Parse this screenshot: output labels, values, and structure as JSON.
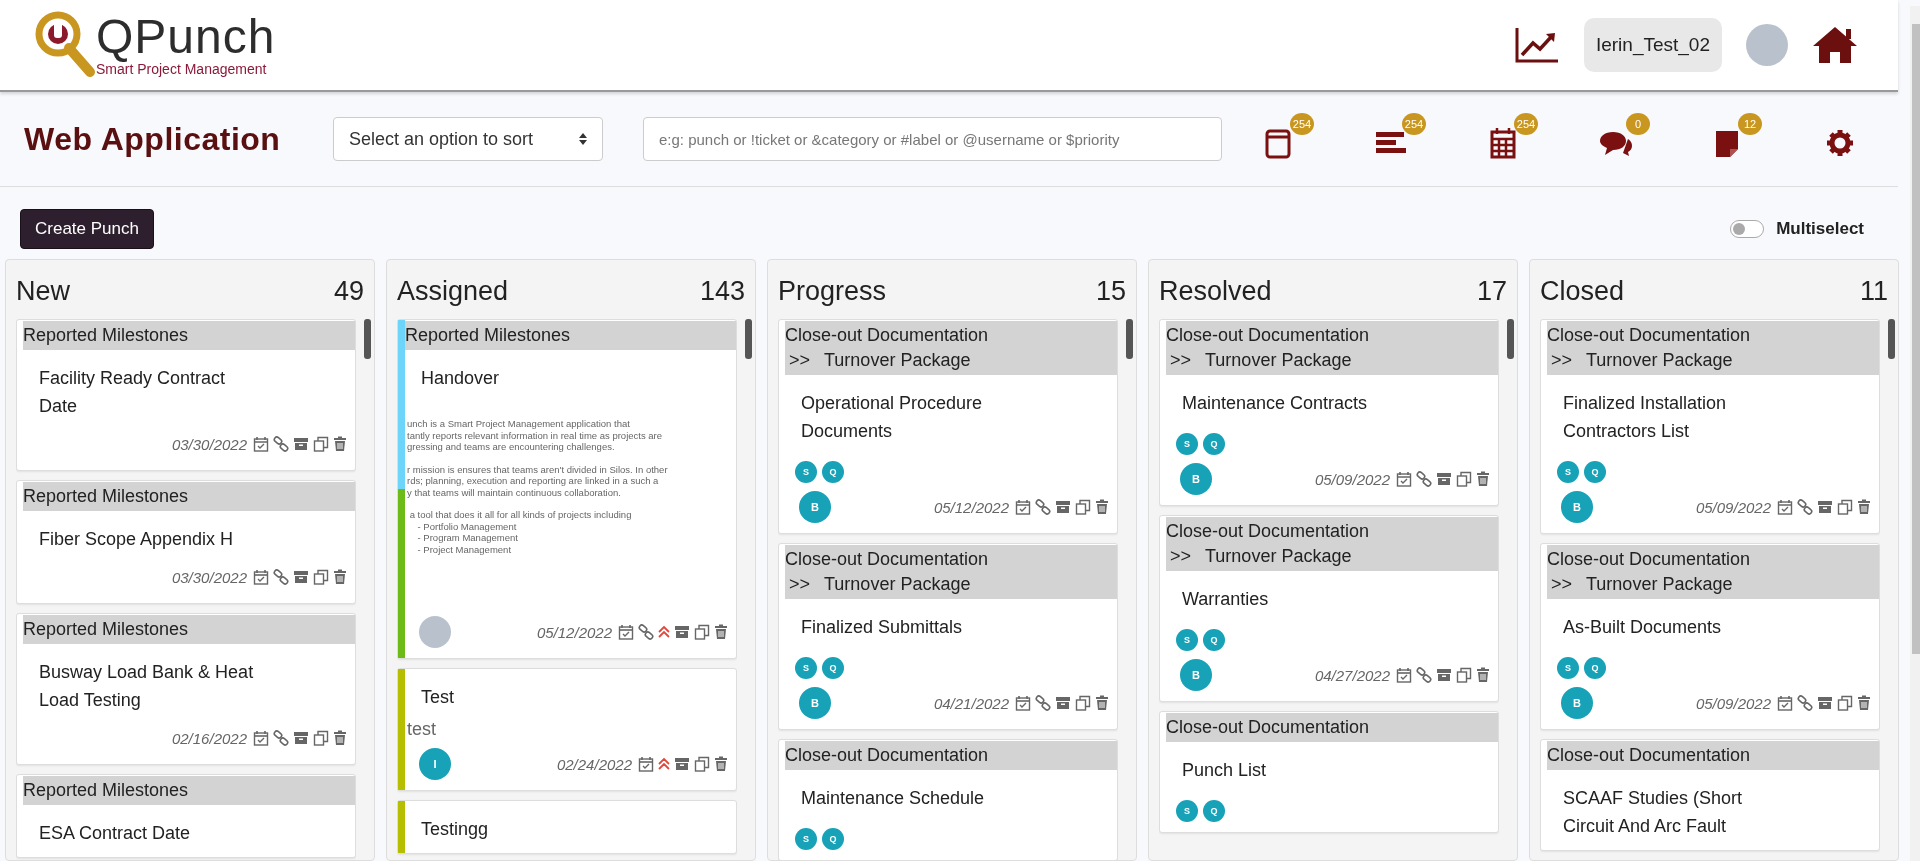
{
  "header": {
    "logo": {
      "name": "QPunch",
      "tagline": "Smart Project Management"
    },
    "user": "Ierin_Test_02"
  },
  "toolbar": {
    "title": "Web Application",
    "sort": {
      "placeholder": "Select an option to sort"
    },
    "search": {
      "placeholder": "e:g: punch or !ticket or &category or #label or @username or $priority"
    },
    "views": [
      {
        "kind": "cards",
        "badge": "254"
      },
      {
        "kind": "list",
        "badge": "254"
      },
      {
        "kind": "calendar",
        "badge": "254"
      },
      {
        "kind": "chat",
        "badge": "0"
      },
      {
        "kind": "notes",
        "badge": "12"
      },
      {
        "kind": "settings"
      }
    ]
  },
  "actions": {
    "create_button": "Create Punch",
    "multiselect": {
      "label": "Multiselect",
      "on": false
    }
  },
  "columns": [
    {
      "title": "New",
      "count": "49",
      "cards": [
        {
          "category": "Reported Milestones",
          "title": "Facility Ready Contract Date",
          "date": "03/30/2022",
          "linked": true,
          "high_priority": false
        },
        {
          "category": "Reported Milestones",
          "title": "Fiber Scope Appendix H",
          "date": "03/30/2022",
          "linked": true,
          "high_priority": false
        },
        {
          "category": "Reported Milestones",
          "title": "Busway Load Bank & Heat Load Testing",
          "date": "02/16/2022",
          "linked": true,
          "high_priority": false
        },
        {
          "category": "Reported Milestones",
          "title": "ESA Contract Date"
        }
      ]
    },
    {
      "title": "Assigned",
      "count": "143",
      "cards": [
        {
          "category": "Reported Milestones",
          "title": "Handover",
          "accent": [
            {
              "color": "#6dd5fa"
            },
            {
              "color": "#6cbb16"
            }
          ],
          "attachment_paragraphs": [
            [
              "unch is a Smart Project Management application that",
              "tantly reports relevant information in real time as projects are",
              "gressing and teams are encountering challenges."
            ],
            [
              "r mission is ensures that teams aren't divided in Silos. In other",
              "rds; planning, execution and reporting are linked in a such a",
              "y that teams will maintain continuous collaboration."
            ],
            [
              " a tool that does it all for all kinds of projects including",
              "    - Portfolio Management",
              "    - Program Management",
              "    - Project Management"
            ]
          ],
          "assignee": {
            "kind": "photo"
          },
          "date": "05/12/2022",
          "linked": true,
          "high_priority": true
        },
        {
          "title": "Test",
          "description": "test",
          "accent": [
            {
              "color": "#b5be00"
            }
          ],
          "assignee": {
            "kind": "initial",
            "initial": "I"
          },
          "date": "02/24/2022",
          "linked": false,
          "high_priority": true
        },
        {
          "title": "Testingg",
          "accent": [
            {
              "color": "#b5be00"
            }
          ]
        }
      ]
    },
    {
      "title": "Progress",
      "count": "15",
      "cards": [
        {
          "category": "Close-out Documentation",
          "subcategory": {
            "prefix": ">>",
            "name": "Turnover Package"
          },
          "title": "Operational Procedure Documents",
          "tags": [
            "S",
            "Q"
          ],
          "assignee": {
            "kind": "initial",
            "initial": "B"
          },
          "date": "05/12/2022",
          "linked": true,
          "high_priority": false
        },
        {
          "category": "Close-out Documentation",
          "subcategory": {
            "prefix": ">>",
            "name": "Turnover Package"
          },
          "title": "Finalized Submittals",
          "tags": [
            "S",
            "Q"
          ],
          "assignee": {
            "kind": "initial",
            "initial": "B"
          },
          "date": "04/21/2022",
          "linked": true,
          "high_priority": false
        },
        {
          "category": "Close-out Documentation",
          "title": "Maintenance Schedule",
          "tags": [
            "S",
            "Q"
          ]
        }
      ]
    },
    {
      "title": "Resolved",
      "count": "17",
      "cards": [
        {
          "category": "Close-out Documentation",
          "subcategory": {
            "prefix": ">>",
            "name": "Turnover Package"
          },
          "title": "Maintenance Contracts",
          "tags": [
            "S",
            "Q"
          ],
          "assignee": {
            "kind": "initial",
            "initial": "B"
          },
          "date": "05/09/2022",
          "linked": true,
          "high_priority": false
        },
        {
          "category": "Close-out Documentation",
          "subcategory": {
            "prefix": ">>",
            "name": "Turnover Package"
          },
          "title": "Warranties",
          "tags": [
            "S",
            "Q"
          ],
          "assignee": {
            "kind": "initial",
            "initial": "B"
          },
          "date": "04/27/2022",
          "linked": true,
          "high_priority": false
        },
        {
          "category": "Close-out Documentation",
          "title": "Punch List",
          "tags": [
            "S",
            "Q"
          ]
        }
      ]
    },
    {
      "title": "Closed",
      "count": "11",
      "cards": [
        {
          "category": "Close-out Documentation",
          "subcategory": {
            "prefix": ">>",
            "name": "Turnover Package"
          },
          "title": "Finalized Installation Contractors List",
          "tags": [
            "S",
            "Q"
          ],
          "assignee": {
            "kind": "initial",
            "initial": "B"
          },
          "date": "05/09/2022",
          "linked": true,
          "high_priority": false
        },
        {
          "category": "Close-out Documentation",
          "subcategory": {
            "prefix": ">>",
            "name": "Turnover Package"
          },
          "title": "As-Built Documents",
          "tags": [
            "S",
            "Q"
          ],
          "assignee": {
            "kind": "initial",
            "initial": "B"
          },
          "date": "05/09/2022",
          "linked": true,
          "high_priority": false
        },
        {
          "category": "Close-out Documentation",
          "title": "SCAAF Studies (Short Circuit And Arc Fault"
        }
      ]
    }
  ]
}
